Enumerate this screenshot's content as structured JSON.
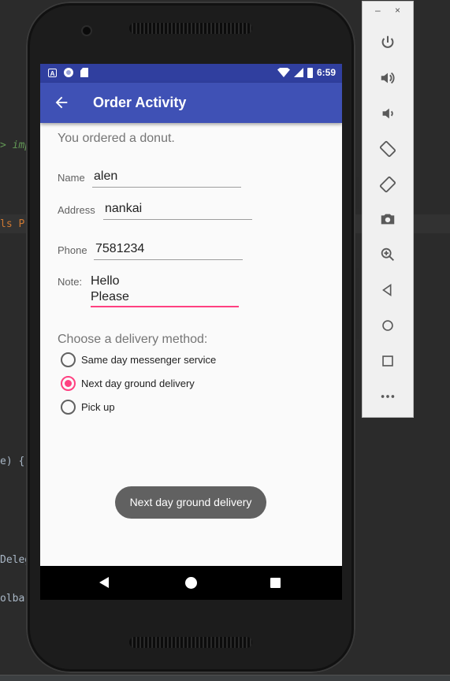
{
  "ide": {
    "line1": "> imp",
    "line2": "ls Pr",
    "line3": "e) {",
    "line4": "Deleg",
    "line5": "olba"
  },
  "statusbar": {
    "time": "6:59",
    "icon_a": "A"
  },
  "toolbar": {
    "title": "Order Activity"
  },
  "form": {
    "ordered_text": "You ordered a donut.",
    "name_label": "Name",
    "name_value": "alen",
    "address_label": "Address",
    "address_value": "nankai",
    "phone_label": "Phone",
    "phone_value": "7581234",
    "note_label": "Note:",
    "note_line1": "Hello",
    "note_line2": "Please"
  },
  "delivery": {
    "heading": "Choose a delivery method:",
    "options": [
      {
        "label": "Same day messenger service",
        "checked": false
      },
      {
        "label": "Next day ground delivery",
        "checked": true
      },
      {
        "label": "Pick up",
        "checked": false
      }
    ]
  },
  "toast": {
    "text": "Next day ground delivery"
  },
  "emulator_panel": {
    "minimize": "–",
    "close": "×",
    "buttons": [
      "power-icon",
      "volume-up-icon",
      "volume-down-icon",
      "rotate-left-icon",
      "rotate-right-icon",
      "camera-icon",
      "zoom-icon",
      "back-icon",
      "home-icon",
      "overview-icon",
      "more-icon"
    ]
  },
  "colors": {
    "primary": "#3f51b5",
    "primary_dark": "#303f9f",
    "accent": "#ff4081"
  }
}
